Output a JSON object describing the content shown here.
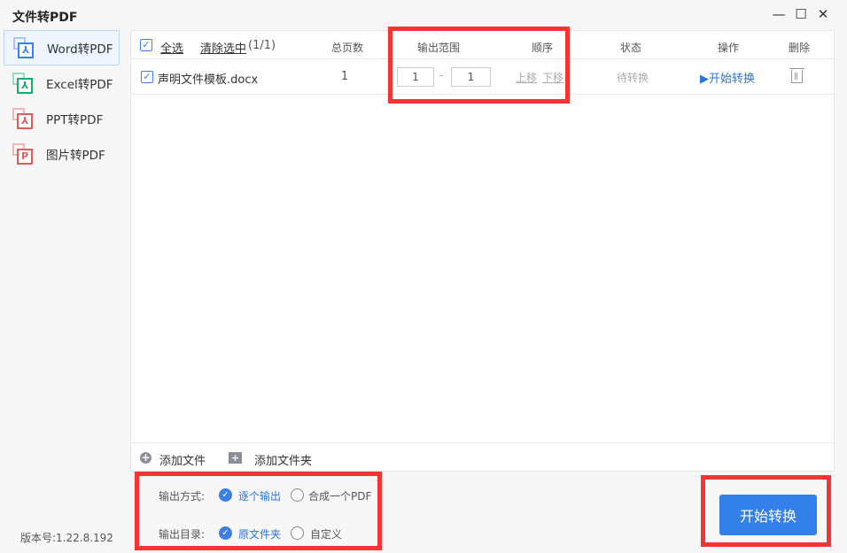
{
  "window": {
    "title": "文件转PDF"
  },
  "sidebar": {
    "items": [
      {
        "label": "Word转PDF",
        "color": "#3b82e6",
        "glyph": "⅄"
      },
      {
        "label": "Excel转PDF",
        "color": "#1aaa6a",
        "glyph": "⅄"
      },
      {
        "label": "PPT转PDF",
        "color": "#e85a5a",
        "glyph": "⅄"
      },
      {
        "label": "图片转PDF",
        "color": "#e85a5a",
        "glyph": "P"
      }
    ],
    "version": "版本号:1.22.8.192"
  },
  "table": {
    "select_all": "全选",
    "clear_selection": "清除选中",
    "count": "(1/1)",
    "headers": {
      "pages": "总页数",
      "range": "输出范围",
      "order": "顺序",
      "status": "状态",
      "action": "操作",
      "delete": "删除"
    },
    "rows": [
      {
        "name": "声明文件模板.docx",
        "pages": "1",
        "range_from": "1",
        "range_sep": "-",
        "range_to": "1",
        "move_up": "上移",
        "move_down": "下移",
        "status": "待转换",
        "action": "▶开始转换"
      }
    ]
  },
  "footer": {
    "add_file": "添加文件",
    "add_folder": "添加文件夹"
  },
  "options": {
    "mode_label": "输出方式:",
    "mode_a": "逐个输出",
    "mode_b": "合成一个PDF",
    "dir_label": "输出目录:",
    "dir_a": "原文件夹",
    "dir_b": "自定义"
  },
  "start_button": "开始转换"
}
